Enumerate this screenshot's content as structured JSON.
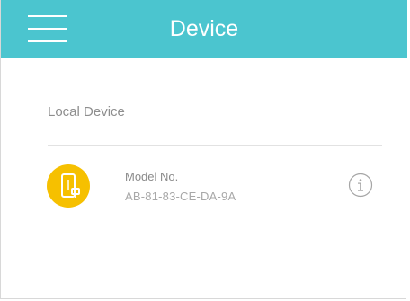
{
  "header": {
    "title": "Device",
    "menu_icon": "hamburger-menu-icon",
    "background_color": "#4bc5cf",
    "text_color": "#ffffff"
  },
  "local_section": {
    "label": "Local Device"
  },
  "device": {
    "icon": "extender-device-icon",
    "icon_color": "#f6c000",
    "model_label": "Model No.",
    "model_value": "AB-81-83-CE-DA-9A",
    "info_icon": "info-icon"
  }
}
